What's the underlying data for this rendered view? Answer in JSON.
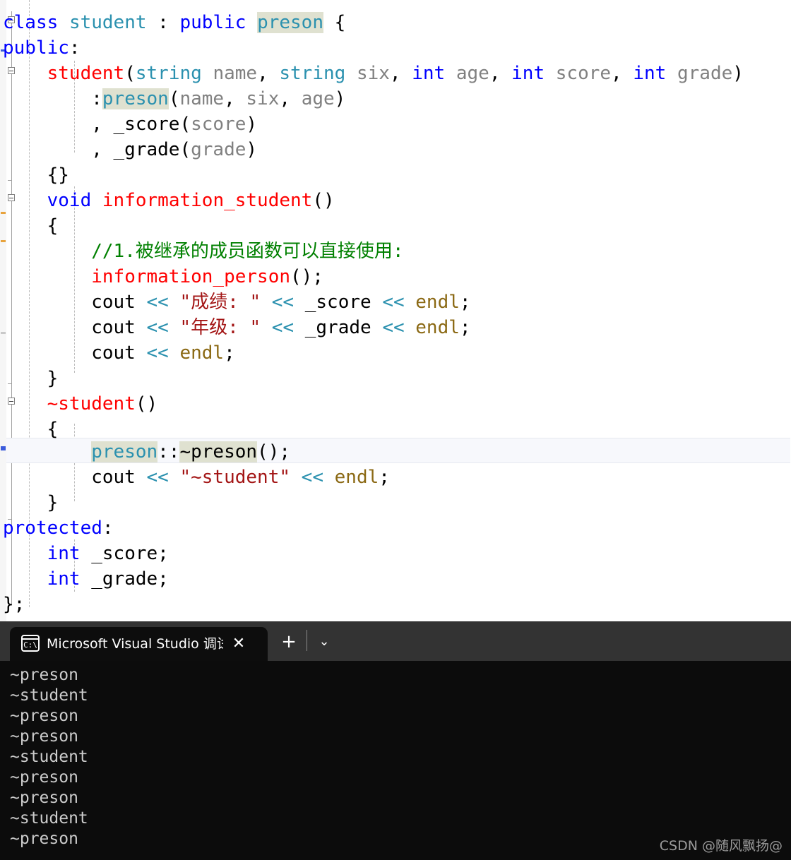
{
  "editor": {
    "language": "cpp",
    "current_line_index": 17,
    "code_lines": [
      "class student : public preson {",
      "public:",
      "    student(string name, string six, int age, int score, int grade)",
      "        :preson(name, six, age)",
      "        , _score(score)",
      "        , _grade(grade)",
      "    {}",
      "    void information_student()",
      "    {",
      "        //1.被继承的成员函数可以直接使用:",
      "        information_person();",
      "        cout << \"成绩: \" << _score << endl;",
      "        cout << \"年级: \" << _grade << endl;",
      "        cout << endl;",
      "    }",
      "    ~student()",
      "    {",
      "        preson::~preson();",
      "        cout << \"~student\" << endl;",
      "    }",
      "protected:",
      "    int _score;",
      "    int _grade;",
      "};"
    ],
    "highlighted_symbol": "preson",
    "comment_text": "//1.被继承的成员函数可以直接使用:",
    "string_literals": [
      "\"成绩: \"",
      "\"年级: \"",
      "\"~student\""
    ],
    "colors": {
      "keyword": "#0000ff",
      "type": "#2b91af",
      "function": "#ff0000",
      "identifier": "#808080",
      "string": "#a31515",
      "comment": "#008000",
      "operator": "#2b91af",
      "endl": "#8b6914",
      "plain": "#000000",
      "reference_highlight_bg": "#dfe1d0",
      "current_line_bg": "#f7f8fc",
      "background": "#ffffff"
    }
  },
  "terminal": {
    "tab": {
      "icon": "console-icon",
      "icon_text": "C:\\",
      "title": "Microsoft Visual Studio 调试控",
      "close_label": "✕"
    },
    "new_tab_label": "+",
    "menu_label": "⌄",
    "output_lines": [
      "~preson",
      "~student",
      "~preson",
      "~preson",
      "~student",
      "~preson",
      "~preson",
      "~student",
      "~preson"
    ],
    "colors": {
      "background": "#0c0c0c",
      "tabbar": "#333333",
      "tab_active": "#0d0d0d",
      "text": "#cccccc"
    }
  },
  "watermark": {
    "text": "CSDN @随风飘扬@"
  }
}
